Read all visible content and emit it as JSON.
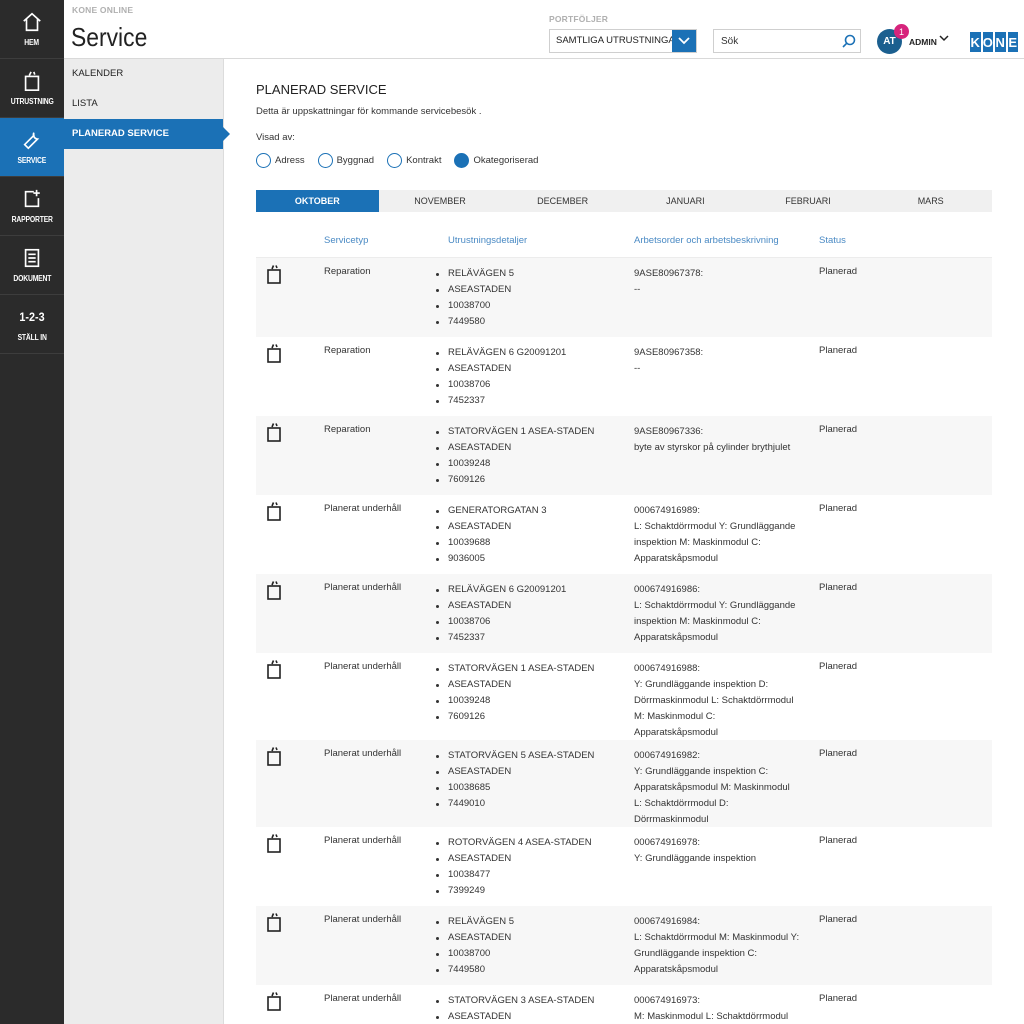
{
  "nav": {
    "items": [
      {
        "label": "HEM",
        "icon": "home-icon"
      },
      {
        "label": "UTRUSTNING",
        "icon": "equipment-icon"
      },
      {
        "label": "SERVICE",
        "icon": "wrench-icon"
      },
      {
        "label": "RAPPORTER",
        "icon": "report-add-icon"
      },
      {
        "label": "DOKUMENT",
        "icon": "document-icon"
      },
      {
        "label": "STÄLL IN",
        "icon_text": "1-2-3"
      }
    ],
    "active_color": "#1b71b6"
  },
  "header": {
    "brand": "KONE ONLINE",
    "title": "Service",
    "portfolio_label": "PORTFÖLJER",
    "portfolio_value": "SAMTLIGA UTRUSTNINGAR",
    "search_placeholder": "Sök",
    "avatar_initials": "AT",
    "notification_count": "1",
    "user_name": "ADMIN",
    "logo_letters": [
      "K",
      "O",
      "N",
      "E"
    ]
  },
  "subnav": {
    "items": [
      "KALENDER",
      "LISTA",
      "PLANERAD SERVICE"
    ],
    "active_index": 2
  },
  "main": {
    "title": "PLANERAD SERVICE",
    "description": "Detta är uppskattningar för kommande servicebesök .",
    "shown_by_label": "Visad av:",
    "radio_options": [
      "Adress",
      "Byggnad",
      "Kontrakt",
      "Okategoriserad"
    ],
    "radio_selected": 3,
    "months": [
      "OKTOBER",
      "NOVEMBER",
      "DECEMBER",
      "JANUARI",
      "FEBRUARI",
      "MARS"
    ],
    "month_selected": 0,
    "columns": [
      "Servicetyp",
      "Utrustningsdetaljer",
      "Arbetsorder och arbetsbeskrivning",
      "Status"
    ],
    "rows": [
      {
        "type": "Reparation",
        "details": [
          "RELÄVÄGEN 5",
          "ASEASTADEN",
          "10038700",
          "7449580"
        ],
        "order": [
          "9ASE80967378:",
          "--"
        ],
        "status": "Planerad"
      },
      {
        "type": "Reparation",
        "details": [
          "RELÄVÄGEN 6 G20091201",
          "ASEASTADEN",
          "10038706",
          "7452337"
        ],
        "order": [
          "9ASE80967358:",
          "--"
        ],
        "status": "Planerad"
      },
      {
        "type": "Reparation",
        "details": [
          "STATORVÄGEN 1 ASEA-STADEN",
          "ASEASTADEN",
          "10039248",
          "7609126"
        ],
        "order": [
          "9ASE80967336:",
          "byte av styrskor på cylinder brythjulet"
        ],
        "status": "Planerad"
      },
      {
        "type": "Planerat underhåll",
        "details": [
          "GENERATORGATAN 3",
          "ASEASTADEN",
          "10039688",
          "9036005"
        ],
        "order": [
          "000674916989:",
          "L: Schaktdörrmodul Y: Grundläggande",
          "inspektion M: Maskinmodul C:",
          "Apparatskåpsmodul"
        ],
        "status": "Planerad"
      },
      {
        "type": "Planerat underhåll",
        "details": [
          "RELÄVÄGEN 6 G20091201",
          "ASEASTADEN",
          "10038706",
          "7452337"
        ],
        "order": [
          "000674916986:",
          "L: Schaktdörrmodul Y: Grundläggande",
          "inspektion M: Maskinmodul C:",
          "Apparatskåpsmodul"
        ],
        "status": "Planerad"
      },
      {
        "type": "Planerat underhåll",
        "details": [
          "STATORVÄGEN 1 ASEA-STADEN",
          "ASEASTADEN",
          "10039248",
          "7609126"
        ],
        "order": [
          "000674916988:",
          "Y: Grundläggande inspektion D:",
          "Dörrmaskinmodul L: Schaktdörrmodul",
          "M: Maskinmodul C:",
          "Apparatskåpsmodul"
        ],
        "status": "Planerad"
      },
      {
        "type": "Planerat underhåll",
        "details": [
          "STATORVÄGEN 5 ASEA-STADEN",
          "ASEASTADEN",
          "10038685",
          "7449010"
        ],
        "order": [
          "000674916982:",
          "Y: Grundläggande inspektion C:",
          "Apparatskåpsmodul M: Maskinmodul",
          "L: Schaktdörrmodul D:",
          "Dörrmaskinmodul"
        ],
        "status": "Planerad"
      },
      {
        "type": "Planerat underhåll",
        "details": [
          "ROTORVÄGEN 4 ASEA-STADEN",
          "ASEASTADEN",
          "10038477",
          "7399249"
        ],
        "order": [
          "000674916978:",
          "Y: Grundläggande inspektion"
        ],
        "status": "Planerad"
      },
      {
        "type": "Planerat underhåll",
        "details": [
          "RELÄVÄGEN 5",
          "ASEASTADEN",
          "10038700",
          "7449580"
        ],
        "order": [
          "000674916984:",
          "L: Schaktdörrmodul M: Maskinmodul Y:",
          "Grundläggande inspektion C:",
          "Apparatskåpsmodul"
        ],
        "status": "Planerad"
      },
      {
        "type": "Planerat underhåll",
        "details": [
          "STATORVÄGEN 3 ASEA-STADEN",
          "ASEASTADEN"
        ],
        "order": [
          "000674916973:",
          "M: Maskinmodul L: Schaktdörrmodul"
        ],
        "status": "Planerad"
      }
    ]
  }
}
